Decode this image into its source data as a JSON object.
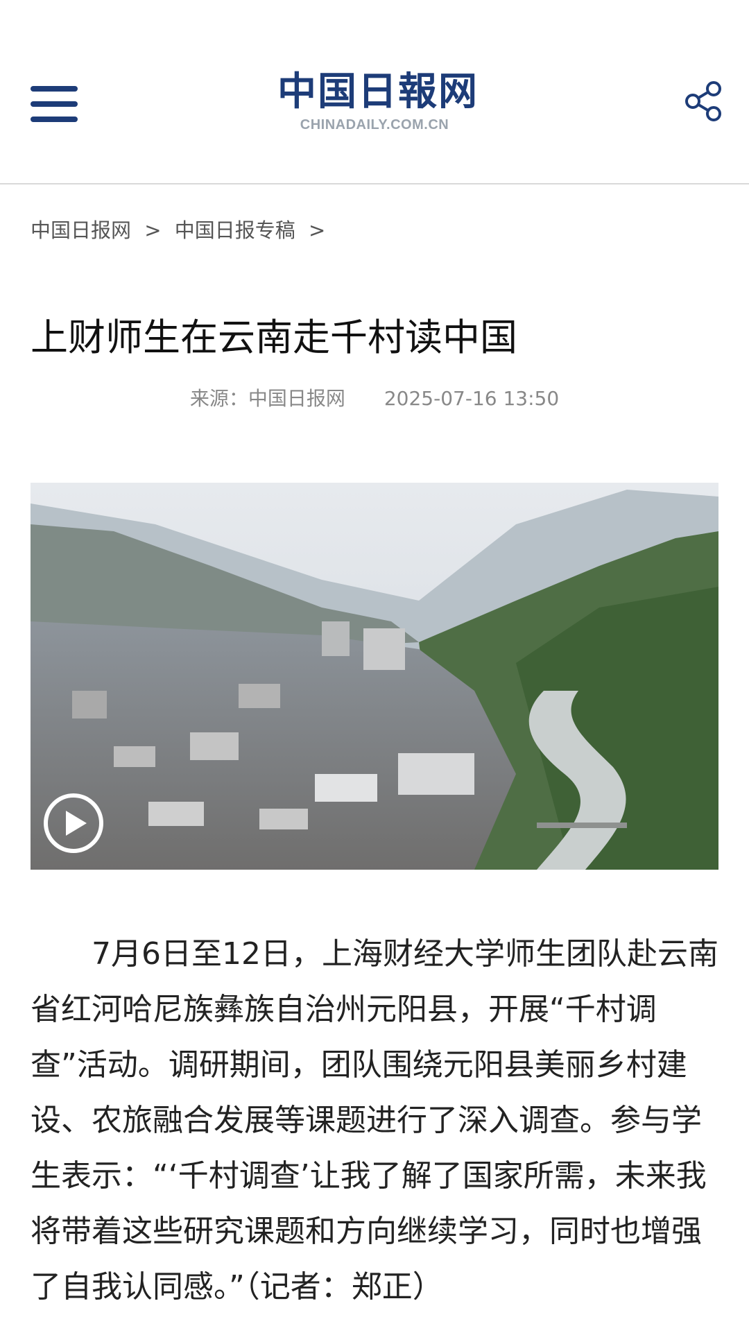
{
  "header": {
    "menu_icon": "hamburger-menu-icon",
    "logo_cn": "中国日報网",
    "logo_en": "CHINADAILY.COM.CN",
    "share_icon": "share-icon",
    "brand_color": "#1d3c78"
  },
  "breadcrumb": {
    "items": [
      "中国日报网",
      "中国日报专稿"
    ],
    "separator": ">"
  },
  "article": {
    "title": "上财师生在云南走千村读中国",
    "source_label": "来源：",
    "source": "中国日报网",
    "datetime": "2025-07-16 13:50",
    "video": {
      "play_icon": "play-icon"
    },
    "body": "7月6日至12日，上海财经大学师生团队赴云南省红河哈尼族彝族自治州元阳县，开展“千村调查”活动。调研期间，团队围绕元阳县美丽乡村建设、农旅融合发展等课题进行了深入调查。参与学生表示：“‘千村调查’让我了解了国家所需，未来我将带着这些研究课题和方向继续学习，同时也增强了自我认同感。”（记者：郑正）"
  }
}
